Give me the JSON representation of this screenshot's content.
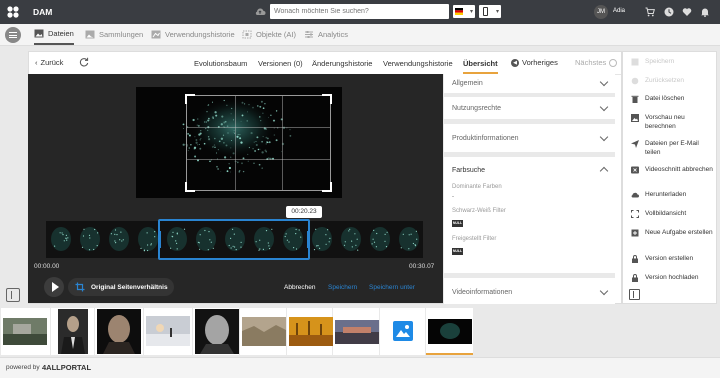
{
  "app": {
    "name": "DAM"
  },
  "topbar": {
    "search_placeholder": "Wonach möchten Sie suchen?",
    "user_initials": "JM",
    "user_name": "Adia"
  },
  "nav": {
    "tabs": [
      {
        "label": "Dateien",
        "active": true
      },
      {
        "label": "Sammlungen"
      },
      {
        "label": "Verwendungshistorie"
      },
      {
        "label": "Objekte (AI)"
      },
      {
        "label": "Analytics"
      }
    ]
  },
  "toolbar": {
    "back": "Zurück",
    "tabs": [
      "Evolutionsbaum",
      "Versionen (0)",
      "Änderungshistorie",
      "Verwendungshistorie",
      "Übersicht"
    ],
    "active_tab": "Übersicht",
    "previous": "Vorheriges",
    "next": "Nächstes"
  },
  "video": {
    "time_current": "00:20.23",
    "time_start": "00:00.00",
    "time_end": "00:30.07",
    "aspect_label": "Original Seitenverhältnis",
    "cancel": "Abbrechen",
    "save": "Speichern",
    "save_as": "Speichern unter"
  },
  "meta": {
    "sections": {
      "general": "Allgemein",
      "rights": "Nutzungsrechte",
      "product": "Produktinformationen",
      "color": "Farbsuche",
      "video_info": "Videoinformationen"
    },
    "color_fields": {
      "dominant_label": "Dominante Farben",
      "dominant_value": "-",
      "bw_label": "Schwarz-Weiß Filter",
      "bw_value": "NULL",
      "cutout_label": "Freigestellt Filter",
      "cutout_value": "NULL"
    }
  },
  "actions": [
    {
      "label": "Speichern",
      "icon": "save-icon",
      "enabled": false
    },
    {
      "label": "Zurücksetzen",
      "icon": "reset-icon",
      "enabled": false
    },
    {
      "label": "Datei löschen",
      "icon": "trash-icon",
      "enabled": true
    },
    {
      "label": "Vorschau neu berechnen",
      "icon": "image-icon",
      "enabled": true
    },
    {
      "label": "Dateien per E-Mail teilen",
      "icon": "send-icon",
      "enabled": true
    },
    {
      "label": "Videoschnitt abbrechen",
      "icon": "cancel-icon",
      "enabled": true
    },
    {
      "label": "Herunterladen",
      "icon": "cloud-download-icon",
      "enabled": true
    },
    {
      "label": "Vollbildansicht",
      "icon": "fullscreen-icon",
      "enabled": true
    },
    {
      "label": "Neue Aufgabe erstellen",
      "icon": "task-icon",
      "enabled": true
    },
    {
      "label": "Version erstellen",
      "icon": "lock-icon",
      "enabled": true
    },
    {
      "label": "Version hochladen",
      "icon": "lock-upload-icon",
      "enabled": true
    }
  ],
  "footer": {
    "powered_by": "powered by",
    "brand": "4ALLPORTAL"
  },
  "colors": {
    "accent": "#e8a33d",
    "selection": "#2a84d1",
    "topbar": "#3a3d42",
    "link": "#2a84d1"
  }
}
